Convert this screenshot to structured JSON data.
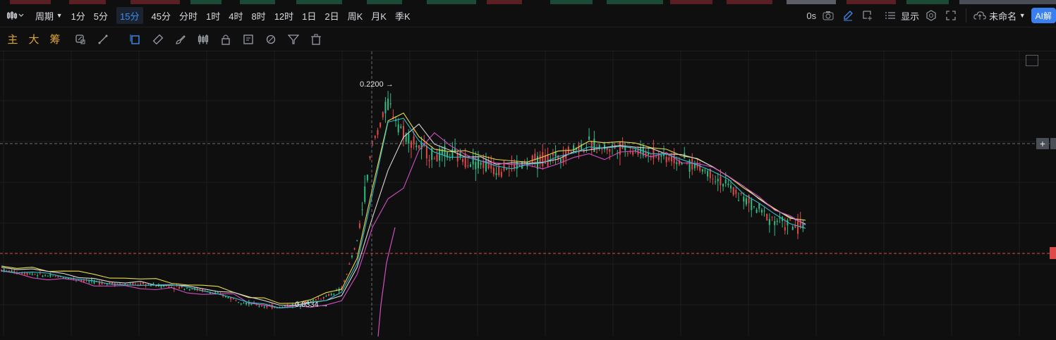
{
  "topbar": {
    "chart_type_icon": "candlestick-icon",
    "period_label": "周期",
    "intervals": [
      "1分",
      "5分",
      "15分",
      "45分",
      "分时",
      "1时",
      "4时",
      "8时",
      "12时",
      "1日",
      "2日",
      "周K",
      "月K",
      "季K"
    ],
    "active_interval": "15分",
    "countdown": "0s",
    "display_label": "显示",
    "layout_name": "未命名",
    "ai_label": "AI解"
  },
  "toolbar2": {
    "indicators": [
      "主",
      "大",
      "筹"
    ],
    "tools": [
      "magnet-icon",
      "measure-icon",
      "select-icon",
      "ruler-icon",
      "brush-icon",
      "candle-pattern-icon",
      "lock-icon",
      "note-icon",
      "link-icon",
      "filter-icon",
      "trash-icon"
    ]
  },
  "chart": {
    "high_label": "0.2200",
    "low_label": "0.0334",
    "colors": {
      "background": "#0f0f10",
      "grid": "#1c1d21",
      "up": "#2ebd85",
      "down": "#e0494a",
      "ma_yellow": "#e8d84b",
      "ma_white": "#d8d8d8",
      "ma_magenta": "#d24fc0",
      "ma_cyan": "#35b9c9",
      "crosshair": "#6b6e75",
      "price_line": "#e0494a"
    }
  },
  "chart_data": {
    "type": "line",
    "title": "",
    "series": [
      {
        "values": [
          0.066,
          0.064,
          0.063,
          0.061,
          0.06,
          0.058,
          0.056,
          0.055,
          0.054,
          0.054,
          0.053,
          0.052,
          0.051,
          0.049,
          0.046,
          0.042,
          0.038,
          0.036,
          0.035,
          0.037,
          0.04,
          0.044,
          0.05,
          0.09,
          0.17,
          0.205,
          0.18,
          0.168,
          0.16,
          0.162,
          0.158,
          0.155,
          0.15,
          0.152,
          0.154,
          0.158,
          0.16,
          0.167,
          0.17,
          0.167,
          0.168,
          0.165,
          0.163,
          0.16,
          0.156,
          0.152,
          0.145,
          0.135,
          0.125,
          0.115,
          0.108,
          0.103,
          0.1
        ]
      }
    ],
    "annotations": [
      "0.2200",
      "0.0334"
    ]
  }
}
